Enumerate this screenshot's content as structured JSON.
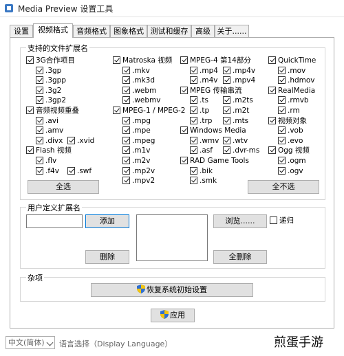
{
  "window": {
    "title": "Media Preview 设置工具"
  },
  "tabs": [
    {
      "label": "设置",
      "active": false
    },
    {
      "label": "视频格式",
      "active": true
    },
    {
      "label": "音频格式",
      "active": false
    },
    {
      "label": "图象格式",
      "active": false
    },
    {
      "label": "测试和缓存",
      "active": false
    },
    {
      "label": "高级",
      "active": false
    },
    {
      "label": "关于......",
      "active": false
    }
  ],
  "supported": {
    "title": "支持的文件扩展名",
    "col1": [
      {
        "label": "3G合作项目",
        "checked": true,
        "level": 0
      },
      {
        "label": ".3gp",
        "checked": true,
        "level": 1
      },
      {
        "label": ".3gpp",
        "checked": true,
        "level": 1
      },
      {
        "label": ".3g2",
        "checked": true,
        "level": 1
      },
      {
        "label": ".3gp2",
        "checked": true,
        "level": 1
      },
      {
        "label": "音频视频重叠",
        "checked": true,
        "level": 0
      },
      {
        "label": ".avi",
        "checked": true,
        "level": 1
      },
      {
        "label": ".amv",
        "checked": true,
        "level": 1
      },
      {
        "label": ".divx",
        "checked": true,
        "level": 1
      },
      {
        "label": "Flash 视频",
        "checked": true,
        "level": 0
      },
      {
        "label": ".flv",
        "checked": true,
        "level": 1
      },
      {
        "label": ".f4v",
        "checked": true,
        "level": 1
      }
    ],
    "col1_extra": [
      {
        "label": ".xvid",
        "checked": true
      },
      {
        "label": ".swf",
        "checked": true
      }
    ],
    "col2": [
      {
        "label": "Matroska 视频",
        "checked": true,
        "level": 0
      },
      {
        "label": ".mkv",
        "checked": true,
        "level": 1
      },
      {
        "label": ".mk3d",
        "checked": true,
        "level": 1
      },
      {
        "label": ".webm",
        "checked": true,
        "level": 1
      },
      {
        "label": ".webmv",
        "checked": true,
        "level": 1
      },
      {
        "label": "MPEG-1 / MPEG-2",
        "checked": true,
        "level": 0
      },
      {
        "label": ".mpg",
        "checked": true,
        "level": 1
      },
      {
        "label": ".mpe",
        "checked": true,
        "level": 1
      },
      {
        "label": ".mpeg",
        "checked": true,
        "level": 1
      },
      {
        "label": ".m1v",
        "checked": true,
        "level": 1
      },
      {
        "label": ".m2v",
        "checked": true,
        "level": 1
      },
      {
        "label": ".mp2v",
        "checked": true,
        "level": 1
      },
      {
        "label": ".mpv2",
        "checked": true,
        "level": 1
      }
    ],
    "col3": [
      {
        "label": "MPEG-4 第14部分",
        "checked": true,
        "level": 0
      },
      {
        "label": ".mp4",
        "checked": true,
        "level": 1
      },
      {
        "label": ".m4v",
        "checked": true,
        "level": 1
      },
      {
        "label": "MPEG 传输串流",
        "checked": true,
        "level": 0
      },
      {
        "label": ".ts",
        "checked": true,
        "level": 1
      },
      {
        "label": ".tp",
        "checked": true,
        "level": 1
      },
      {
        "label": ".trp",
        "checked": true,
        "level": 1
      },
      {
        "label": "Windows Media",
        "checked": true,
        "level": 0
      },
      {
        "label": ".wmv",
        "checked": true,
        "level": 1
      },
      {
        "label": ".asf",
        "checked": true,
        "level": 1
      },
      {
        "label": "RAD Game Tools",
        "checked": true,
        "level": 0
      },
      {
        "label": ".bik",
        "checked": true,
        "level": 1
      },
      {
        "label": ".smk",
        "checked": true,
        "level": 1
      }
    ],
    "col3b": [
      {
        "label": ".mp4v",
        "checked": true
      },
      {
        "label": ".mpv4",
        "checked": true
      },
      {
        "label": ".m2ts",
        "checked": true
      },
      {
        "label": ".m2t",
        "checked": true
      },
      {
        "label": ".mts",
        "checked": true
      },
      {
        "label": ".wtv",
        "checked": true
      },
      {
        "label": ".dvr-ms",
        "checked": true
      }
    ],
    "col4": [
      {
        "label": "QuickTime",
        "checked": true,
        "level": 0
      },
      {
        "label": ".mov",
        "checked": true,
        "level": 1
      },
      {
        "label": ".hdmov",
        "checked": true,
        "level": 1
      },
      {
        "label": "RealMedia",
        "checked": true,
        "level": 0
      },
      {
        "label": ".rmvb",
        "checked": true,
        "level": 1
      },
      {
        "label": ".rm",
        "checked": true,
        "level": 1
      },
      {
        "label": "视频对象",
        "checked": true,
        "level": 0
      },
      {
        "label": ".vob",
        "checked": true,
        "level": 1
      },
      {
        "label": ".evo",
        "checked": true,
        "level": 1
      },
      {
        "label": "Ogg 视频",
        "checked": true,
        "level": 0
      },
      {
        "label": ".ogm",
        "checked": true,
        "level": 1
      },
      {
        "label": ".ogv",
        "checked": true,
        "level": 1
      }
    ],
    "select_all": "全选",
    "select_none": "全不选"
  },
  "custom": {
    "title": "用户定义扩展名",
    "input_value": "",
    "add_button": "添加",
    "delete_button": "删除",
    "browse_button": "浏览......",
    "recursive_label": "递归",
    "recursive_checked": false,
    "delete_all_button": "全删除"
  },
  "misc": {
    "title": "杂项",
    "restore_button": "恢复系统初始设置"
  },
  "apply_button": "应用",
  "language": {
    "selected": "中文(简体)",
    "label": "语言选择（Display Language）"
  },
  "watermark": "煎蛋手游"
}
